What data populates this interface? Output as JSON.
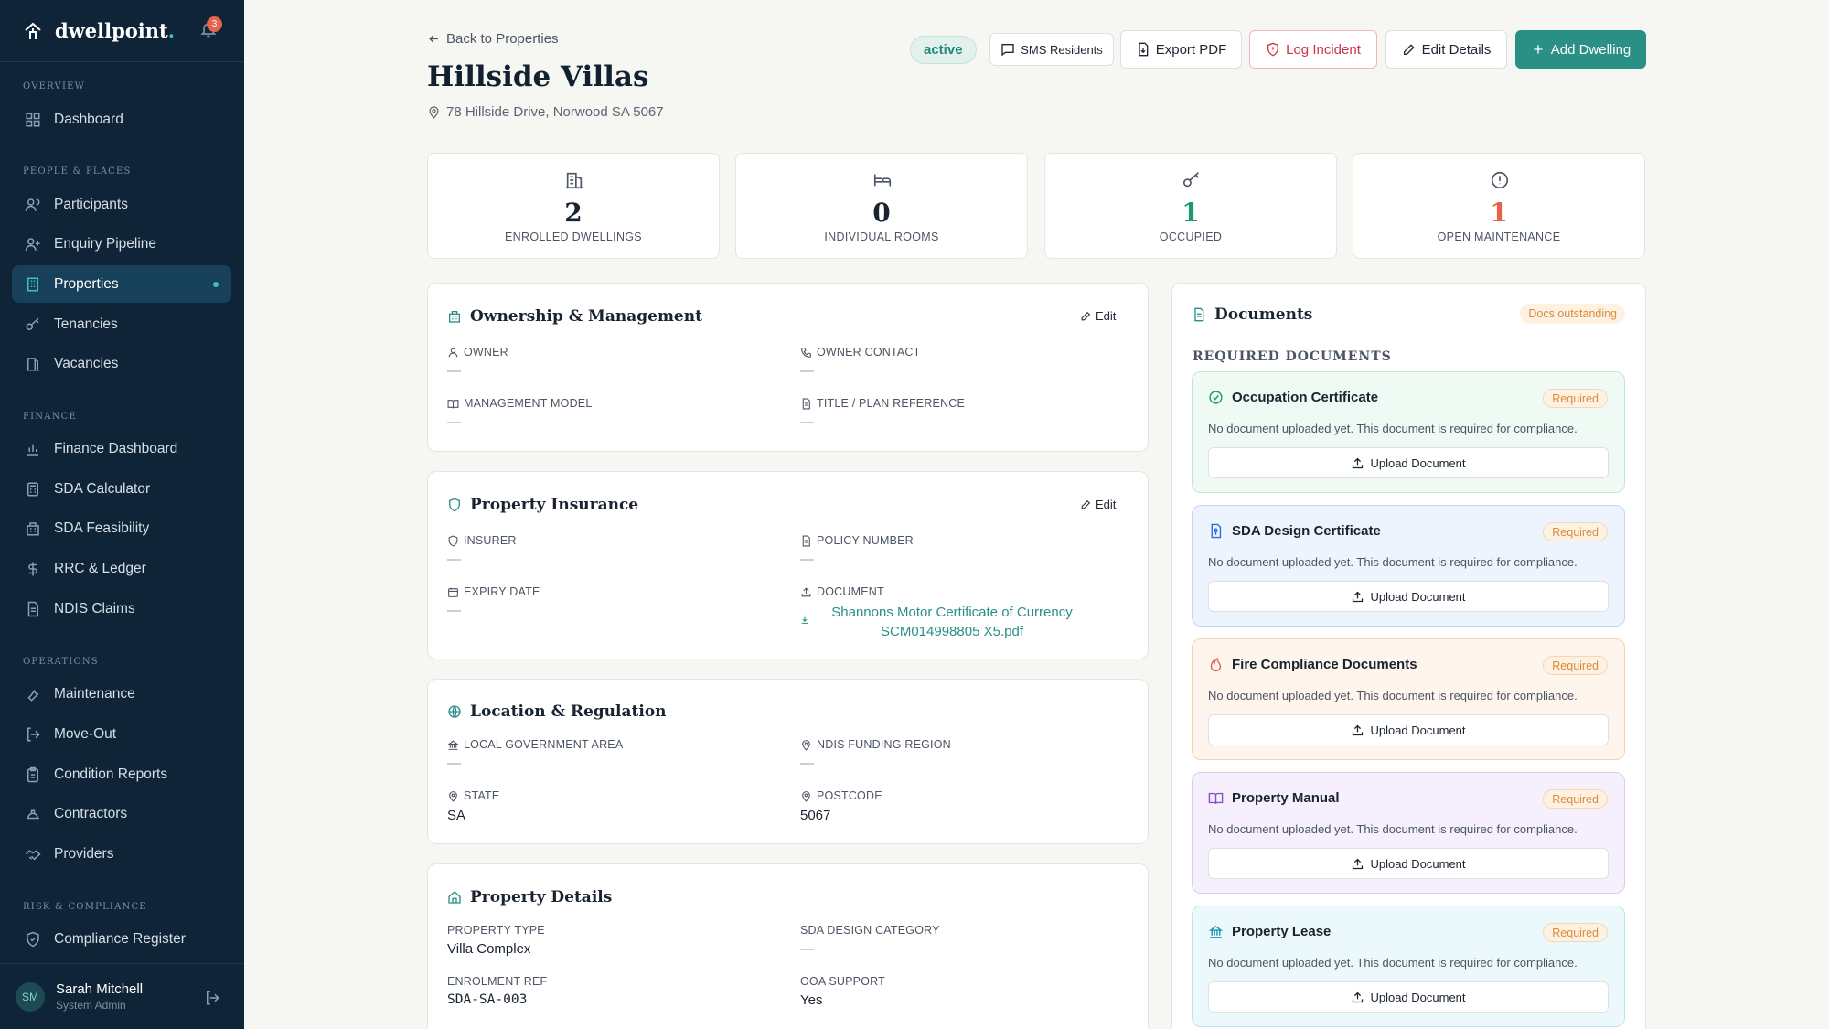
{
  "brand": {
    "name_main": "dwellpoint",
    "name_accent": ".",
    "notification_count": "3"
  },
  "nav": {
    "sections": {
      "overview": "OVERVIEW",
      "people": "PEOPLE & PLACES",
      "finance": "FINANCE",
      "operations": "OPERATIONS",
      "risk": "RISK & COMPLIANCE"
    },
    "items": {
      "dashboard": "Dashboard",
      "participants": "Participants",
      "enquiry": "Enquiry Pipeline",
      "properties": "Properties",
      "tenancies": "Tenancies",
      "vacancies": "Vacancies",
      "finance_dashboard": "Finance Dashboard",
      "sda_calculator": "SDA Calculator",
      "sda_feasibility": "SDA Feasibility",
      "rrc": "RRC & Ledger",
      "ndis": "NDIS Claims",
      "maintenance": "Maintenance",
      "move_out": "Move-Out",
      "condition": "Condition Reports",
      "contractors": "Contractors",
      "providers": "Providers",
      "compliance": "Compliance Register"
    }
  },
  "user": {
    "initials": "SM",
    "name": "Sarah Mitchell",
    "role": "System Admin"
  },
  "header": {
    "back_label": "Back to Properties",
    "title": "Hillside Villas",
    "address": "78 Hillside Drive, Norwood SA 5067",
    "status": "active",
    "buttons": {
      "sms": "SMS Residents",
      "export": "Export PDF",
      "incident": "Log Incident",
      "edit": "Edit Details",
      "add": "Add Dwelling"
    }
  },
  "stats": [
    {
      "value": "2",
      "label": "ENROLLED DWELLINGS",
      "color": "#1a2330"
    },
    {
      "value": "0",
      "label": "INDIVIDUAL ROOMS",
      "color": "#1a2330"
    },
    {
      "value": "1",
      "label": "OCCUPIED",
      "color": "#1e9a6a"
    },
    {
      "value": "1",
      "label": "OPEN MAINTENANCE",
      "color": "#e4634a"
    }
  ],
  "ownership": {
    "title": "Ownership & Management",
    "edit": "Edit",
    "owner_label": "OWNER",
    "owner_value": "—",
    "contact_label": "OWNER CONTACT",
    "contact_value": "—",
    "model_label": "MANAGEMENT MODEL",
    "model_value": "—",
    "title_ref_label": "TITLE / PLAN REFERENCE",
    "title_ref_value": "—"
  },
  "insurance": {
    "title": "Property Insurance",
    "edit": "Edit",
    "insurer_label": "INSURER",
    "insurer_value": "—",
    "policy_label": "POLICY NUMBER",
    "policy_value": "—",
    "expiry_label": "EXPIRY DATE",
    "expiry_value": "—",
    "document_label": "DOCUMENT",
    "document_line1": "Shannons Motor Certificate of Currency",
    "document_line2": "SCM014998805 X5.pdf"
  },
  "location": {
    "title": "Location & Regulation",
    "lga_label": "LOCAL GOVERNMENT AREA",
    "lga_value": "—",
    "region_label": "NDIS FUNDING REGION",
    "region_value": "—",
    "state_label": "STATE",
    "state_value": "SA",
    "postcode_label": "POSTCODE",
    "postcode_value": "5067"
  },
  "details": {
    "title": "Property Details",
    "type_label": "PROPERTY TYPE",
    "type_value": "Villa Complex",
    "sda_label": "SDA DESIGN CATEGORY",
    "sda_value": "—",
    "ref_label": "ENROLMENT REF",
    "ref_value": "SDA-SA-003",
    "ooa_label": "OOA SUPPORT",
    "ooa_value": "Yes"
  },
  "documents": {
    "title": "Documents",
    "outstanding": "Docs outstanding",
    "required_heading": "REQUIRED DOCUMENTS",
    "note": "No document uploaded yet. This document is required for compliance.",
    "required_badge": "Required",
    "upload_label": "Upload Document",
    "items": [
      {
        "name": "Occupation Certificate",
        "bg": "#eefaf3",
        "border": "#bfe8d1",
        "icon_color": "#1e9a6a"
      },
      {
        "name": "SDA Design Certificate",
        "bg": "#eef4fd",
        "border": "#c3d6f2",
        "icon_color": "#2f6fd6"
      },
      {
        "name": "Fire Compliance Documents",
        "bg": "#fef5ec",
        "border": "#f4d3b1",
        "icon_color": "#e4634a"
      },
      {
        "name": "Property Manual",
        "bg": "#f6f0fc",
        "border": "#dccbf0",
        "icon_color": "#8a4fd0"
      },
      {
        "name": "Property Lease",
        "bg": "#ecf9fc",
        "border": "#b9e5ef",
        "icon_color": "#1a97b6"
      }
    ]
  }
}
